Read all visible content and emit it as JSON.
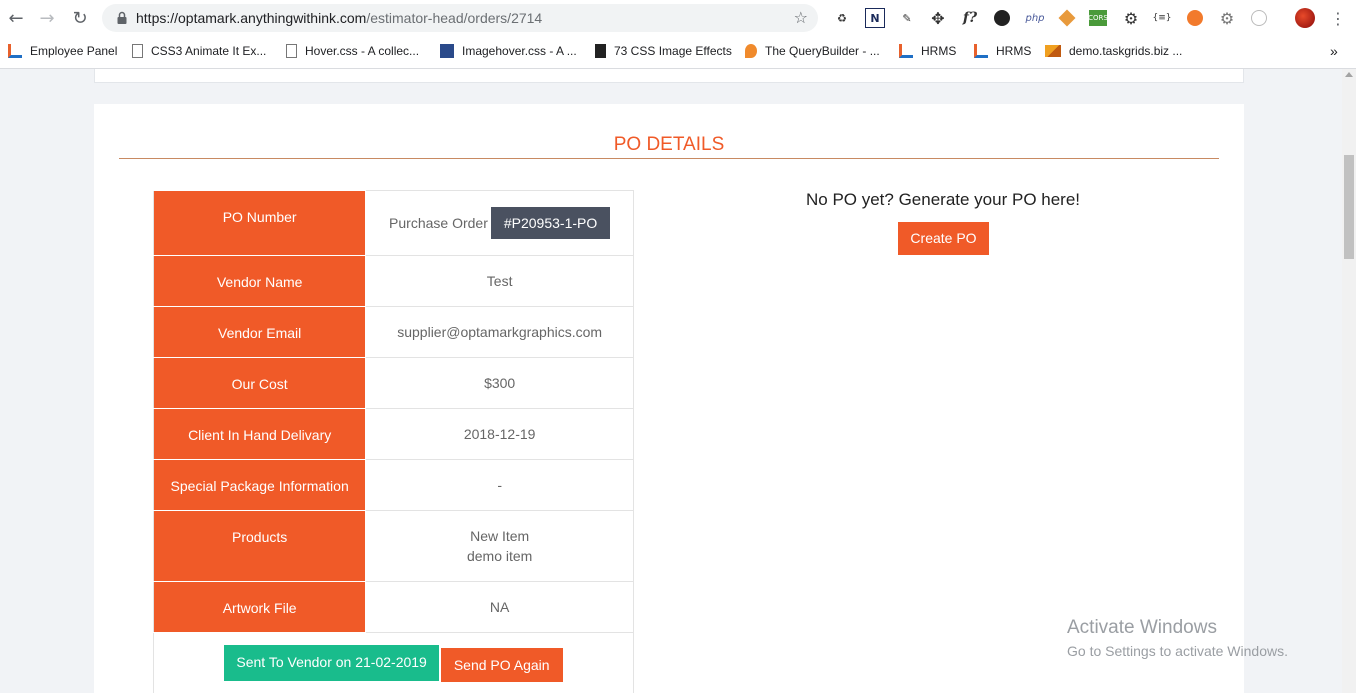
{
  "browser": {
    "url_host": "https://optamark.anythingwithink.com",
    "url_path": "/estimator-head/orders/2714",
    "bookmarks": [
      {
        "label": "Employee Panel"
      },
      {
        "label": "CSS3 Animate It Ex..."
      },
      {
        "label": "Hover.css - A collec..."
      },
      {
        "label": "Imagehover.css - A ..."
      },
      {
        "label": "73 CSS Image Effects"
      },
      {
        "label": "The QueryBuilder - ..."
      },
      {
        "label": "HRMS"
      },
      {
        "label": "HRMS"
      },
      {
        "label": "demo.taskgrids.biz ..."
      }
    ],
    "bookmarks_overflow": "»",
    "extensions": [
      "recycle-icon",
      "n-icon",
      "eyedropper-icon",
      "move-icon",
      "f?",
      "wordpress-icon",
      "php",
      "hammer-icon",
      "CORS",
      "gears-icon",
      "{≡}",
      "orange-circle-icon",
      "settings-icon",
      "clock-icon"
    ]
  },
  "section": {
    "title": "PO DETAILS"
  },
  "po_table": {
    "rows": [
      {
        "label": "PO Number",
        "value_prefix": "Purchase Order",
        "badge": "#P20953-1-PO"
      },
      {
        "label": "Vendor Name",
        "value": "Test"
      },
      {
        "label": "Vendor Email",
        "value": "supplier@optamarkgraphics.com"
      },
      {
        "label": "Our Cost",
        "value": "$300"
      },
      {
        "label": "Client In Hand Delivary",
        "value": "2018-12-19"
      },
      {
        "label": "Special Package Information",
        "value": "-"
      },
      {
        "label": "Products",
        "value_lines": [
          "New Item",
          "demo item"
        ]
      },
      {
        "label": "Artwork File",
        "value": "NA"
      }
    ],
    "sent_button": "Sent To Vendor on 21-02-2019",
    "send_again_button": "Send PO Again"
  },
  "generate": {
    "prompt": "No PO yet? Generate your PO here!",
    "button": "Create PO"
  },
  "watermark": {
    "line1": "Activate Windows",
    "line2": "Go to Settings to activate Windows."
  },
  "colors": {
    "accent": "#f05a28",
    "badge": "#4a5160",
    "success": "#19bc8c"
  }
}
